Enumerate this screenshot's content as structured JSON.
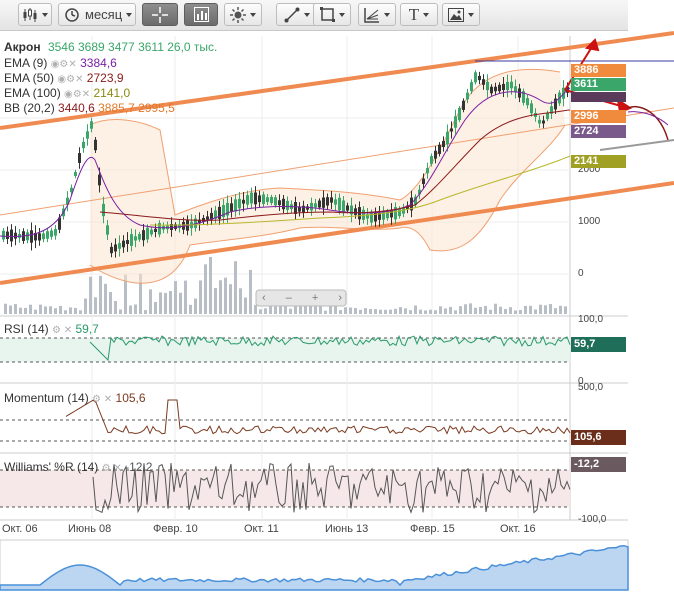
{
  "toolbar": {
    "candle_icon": "candlestick-icon",
    "period_label": "месяц",
    "crosshair_icon": "crosshair-icon",
    "chart_icon": "chart-icon",
    "sun_icon": "sun-icon",
    "line_icon": "line-tool-icon",
    "shape_icon": "shape-icon",
    "fib_icon": "fib-icon",
    "text_icon": "T",
    "image_icon": "image-icon"
  },
  "legend": {
    "ticker": "Акрон",
    "open": "3546",
    "high": "3689",
    "low": "3477",
    "close": "3611",
    "volume": "26,0 тыс.",
    "ema9_label": "EMA (9)",
    "ema9_value": "3384,6",
    "ema50_label": "EMA (50)",
    "ema50_value": "2723,9",
    "ema100_label": "EMA (100)",
    "ema100_value": "2141,0",
    "bb_label": "BB (20,2)",
    "bb_mid": "3440,6",
    "bb_up": "3885,7",
    "bb_low": "2995,5"
  },
  "price_axis": {
    "labels": [
      "2000",
      "1000",
      "0"
    ],
    "tags": [
      "3886",
      "3611",
      "2996",
      "2724",
      "2141"
    ]
  },
  "rsi": {
    "title": "RSI (14)",
    "value": "59,7",
    "axis_top": "100,0",
    "axis_bottom": "0"
  },
  "momentum": {
    "title": "Momentum (14)",
    "value": "105,6",
    "axis_top": "500,0"
  },
  "williams": {
    "title": "Williams' %R (14)",
    "value": "-12,2",
    "axis_bottom": "-100,0"
  },
  "x_axis": [
    "Окт. 06",
    "Июнь 08",
    "Февр. 10",
    "Окт. 11",
    "Июнь 13",
    "Февр. 15",
    "Окт. 16"
  ],
  "zoom_controls": [
    "‹",
    "–",
    "+",
    "›"
  ],
  "colors": {
    "ema9": "#7a1fa2",
    "ema50": "#8b1a1a",
    "ema100": "#b8b82a",
    "bb": "#f08a3c",
    "trend": "#f08a50",
    "rsi": "#2a9a6a",
    "momentum": "#7a3a20",
    "williams": "#555555",
    "tag_green": "#3aa66a",
    "tag_orange": "#f08a3c",
    "tag_purple": "#7a5a8a",
    "tag_olive": "#a0a024"
  }
}
